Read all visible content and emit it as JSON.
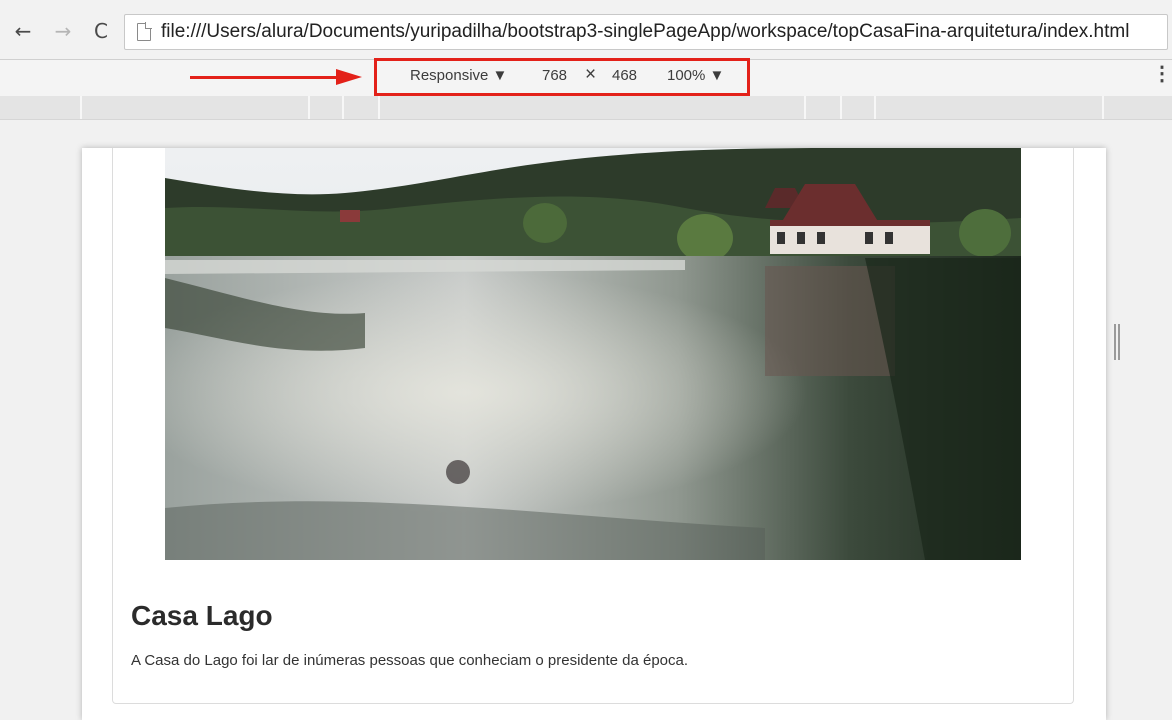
{
  "browser": {
    "back_icon": "arrow-left-icon",
    "forward_icon": "arrow-right-icon",
    "reload_icon": "reload-icon",
    "url": "file:///Users/alura/Documents/yuripadilha/bootstrap3-singlePageApp/workspace/topCasaFina-arquitetura/index.html"
  },
  "device_toolbar": {
    "mode": "Responsive ▼",
    "width": "768",
    "times": "×",
    "height": "468",
    "zoom": "100% ▼",
    "menu_icon": "kebab-menu-icon",
    "annotation_color": "#e32119"
  },
  "card": {
    "title": "Casa Lago",
    "text": "A Casa do Lago foi lar de inúmeras pessoas que conheciam o presidente da época."
  }
}
